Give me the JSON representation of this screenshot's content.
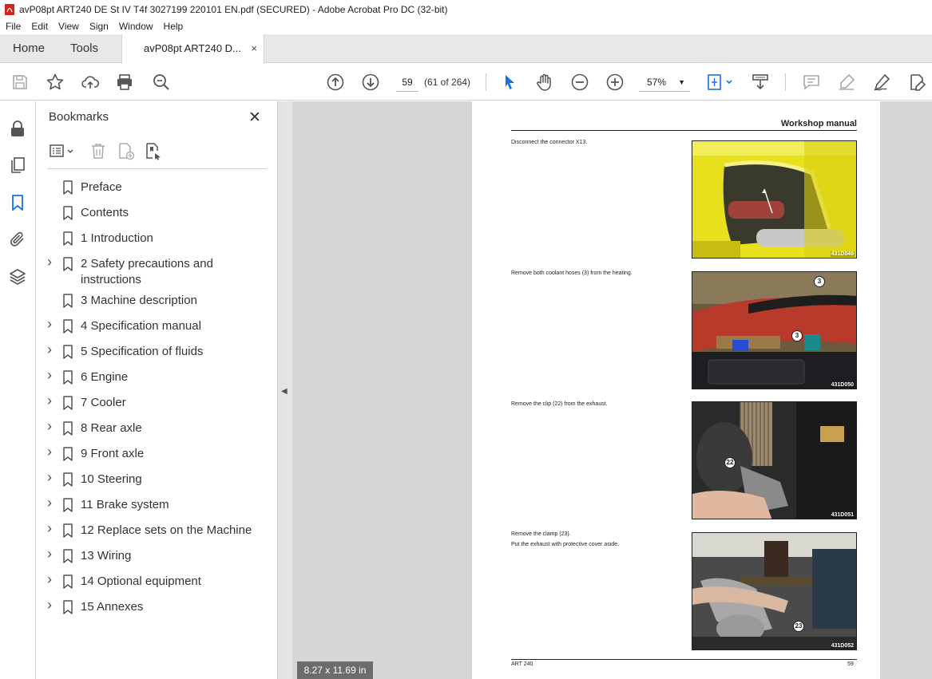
{
  "window": {
    "title": "avP08pt ART240 DE St IV T4f 3027199 220101 EN.pdf (SECURED) - Adobe Acrobat Pro DC (32-bit)"
  },
  "menu": [
    "File",
    "Edit",
    "View",
    "Sign",
    "Window",
    "Help"
  ],
  "tabs": {
    "home": "Home",
    "tools": "Tools",
    "document": "avP08pt ART240 D...",
    "close": "×"
  },
  "toolbar": {
    "current_page": "59",
    "page_count": "(61 of 264)",
    "zoom": "57%",
    "zoom_caret": "▼"
  },
  "bookmarks": {
    "title": "Bookmarks",
    "close": "✕",
    "items": [
      {
        "label": "Preface",
        "expandable": false
      },
      {
        "label": "Contents",
        "expandable": false
      },
      {
        "label": "1 Introduction",
        "expandable": false
      },
      {
        "label": "2 Safety precautions and instructions",
        "expandable": true
      },
      {
        "label": "3 Machine description",
        "expandable": false
      },
      {
        "label": "4 Specification manual",
        "expandable": true
      },
      {
        "label": "5 Specification of fluids",
        "expandable": true
      },
      {
        "label": "6 Engine",
        "expandable": true
      },
      {
        "label": "7 Cooler",
        "expandable": true
      },
      {
        "label": "8 Rear axle",
        "expandable": true
      },
      {
        "label": "9 Front axle",
        "expandable": true
      },
      {
        "label": "10 Steering",
        "expandable": true
      },
      {
        "label": "11 Brake system",
        "expandable": true
      },
      {
        "label": "12 Replace sets on the Machine",
        "expandable": true
      },
      {
        "label": "13 Wiring",
        "expandable": true
      },
      {
        "label": "14 Optional equipment",
        "expandable": true
      },
      {
        "label": "15 Annexes",
        "expandable": true
      }
    ]
  },
  "document": {
    "header": "Workshop manual",
    "steps": [
      {
        "text": "Disconnect the connector X13.",
        "photo_code": "431D049",
        "callouts": []
      },
      {
        "text": "Remove both coolant hoses (3) from the heating.",
        "photo_code": "431D050",
        "callouts": [
          "3",
          "3"
        ]
      },
      {
        "text": "Remove the clip (22) from the exhaust.",
        "photo_code": "431D051",
        "callouts": [
          "22"
        ]
      },
      {
        "text": "Remove the clamp (23).",
        "text2": "Put the exhaust with protective cover aside.",
        "photo_code": "431D052",
        "callouts": [
          "23"
        ]
      }
    ],
    "footer_left": "ART 240",
    "footer_right": "59"
  },
  "status": {
    "page_size": "8.27 x 11.69 in"
  },
  "colors": {
    "acrobat_red": "#d4261c",
    "accent_blue": "#1473e6",
    "icon_gray": "#555555"
  }
}
